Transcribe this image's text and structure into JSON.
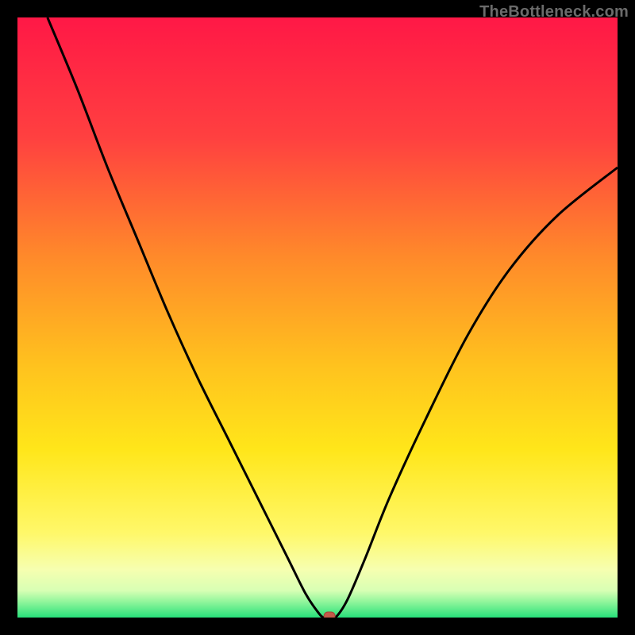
{
  "watermark": "TheBottleneck.com",
  "colors": {
    "frame": "#000000",
    "curve": "#000000",
    "marker_fill": "#c35a4a",
    "marker_stroke": "#a24538",
    "gradient_stops": [
      {
        "offset": 0.0,
        "color": "#ff1846"
      },
      {
        "offset": 0.2,
        "color": "#ff4040"
      },
      {
        "offset": 0.4,
        "color": "#ff8a2a"
      },
      {
        "offset": 0.58,
        "color": "#ffc21e"
      },
      {
        "offset": 0.72,
        "color": "#ffe61a"
      },
      {
        "offset": 0.86,
        "color": "#fff86a"
      },
      {
        "offset": 0.92,
        "color": "#f6ffb0"
      },
      {
        "offset": 0.955,
        "color": "#d8ffb4"
      },
      {
        "offset": 0.975,
        "color": "#8cf59a"
      },
      {
        "offset": 1.0,
        "color": "#28e07a"
      }
    ]
  },
  "chart_data": {
    "type": "line",
    "title": "",
    "xlabel": "",
    "ylabel": "",
    "xlim": [
      0,
      100
    ],
    "ylim": [
      0,
      100
    ],
    "series": [
      {
        "name": "bottleneck-curve",
        "x": [
          5,
          10,
          15,
          20,
          25,
          30,
          35,
          40,
          45,
          48,
          50,
          51,
          52,
          53,
          55,
          58,
          62,
          68,
          75,
          82,
          90,
          100
        ],
        "y": [
          100,
          88,
          75,
          63,
          51,
          40,
          30,
          20,
          10,
          4,
          1,
          0,
          0,
          0,
          3,
          10,
          20,
          33,
          47,
          58,
          67,
          75
        ]
      }
    ],
    "marker": {
      "x": 52,
      "y": 0,
      "name": "optimal-point"
    },
    "grid": false,
    "legend": false
  }
}
